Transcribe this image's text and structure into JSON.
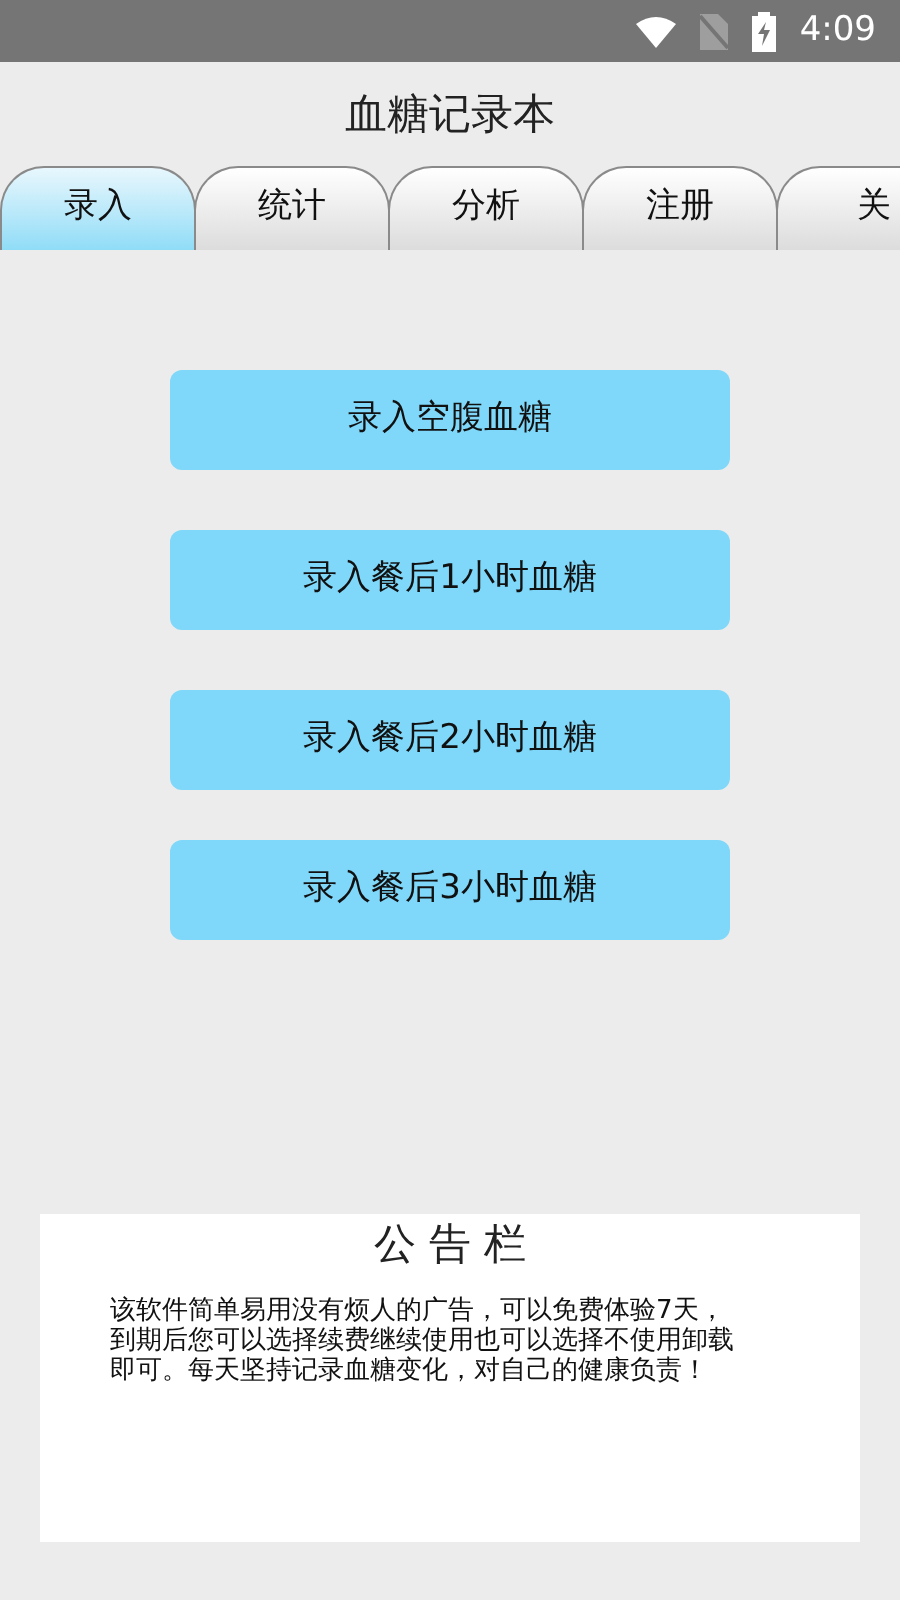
{
  "status_bar": {
    "time": "4:09"
  },
  "title": "血糖记录本",
  "tabs": [
    {
      "label": "录入",
      "selected": true
    },
    {
      "label": "统计",
      "selected": false
    },
    {
      "label": "分析",
      "selected": false
    },
    {
      "label": "注册",
      "selected": false
    },
    {
      "label": "关",
      "selected": false
    }
  ],
  "buttons": [
    "录入空腹血糖",
    "录入餐后1小时血糖",
    "录入餐后2小时血糖",
    "录入餐后3小时血糖"
  ],
  "notice": {
    "title": "公 告 栏",
    "lines": [
      "该软件简单易用没有烦人的广告，可以免费体验7天，",
      "到期后您可以选择续费继续使用也可以选择不使用卸载",
      "即可。每天坚持记录血糖变化，对自己的健康负责！"
    ]
  }
}
